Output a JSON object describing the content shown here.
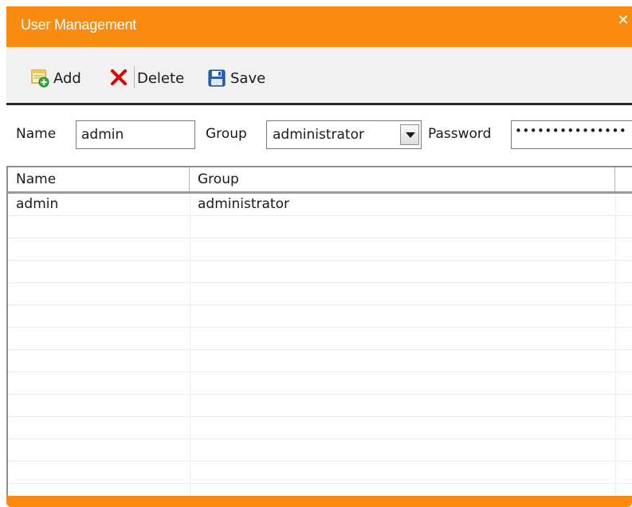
{
  "window": {
    "title": "User Management",
    "close_glyph": "✕"
  },
  "toolbar": {
    "add_label": "Add",
    "add_icon": "add-user-icon",
    "delete_label": "Delete",
    "delete_icon": "delete-x-icon",
    "save_label": "Save",
    "save_icon": "floppy-disk-icon"
  },
  "form": {
    "name_label": "Name",
    "name_value": "admin",
    "group_label": "Group",
    "group_value": "administrator",
    "password_label": "Password",
    "password_mask": "•••••••••••••••"
  },
  "table": {
    "columns": [
      "Name",
      "Group"
    ],
    "rows": [
      [
        "admin",
        "administrator"
      ]
    ]
  },
  "colors": {
    "accent": "#f98b10",
    "delete_red": "#e00000",
    "save_blue": "#2a5fb7"
  }
}
